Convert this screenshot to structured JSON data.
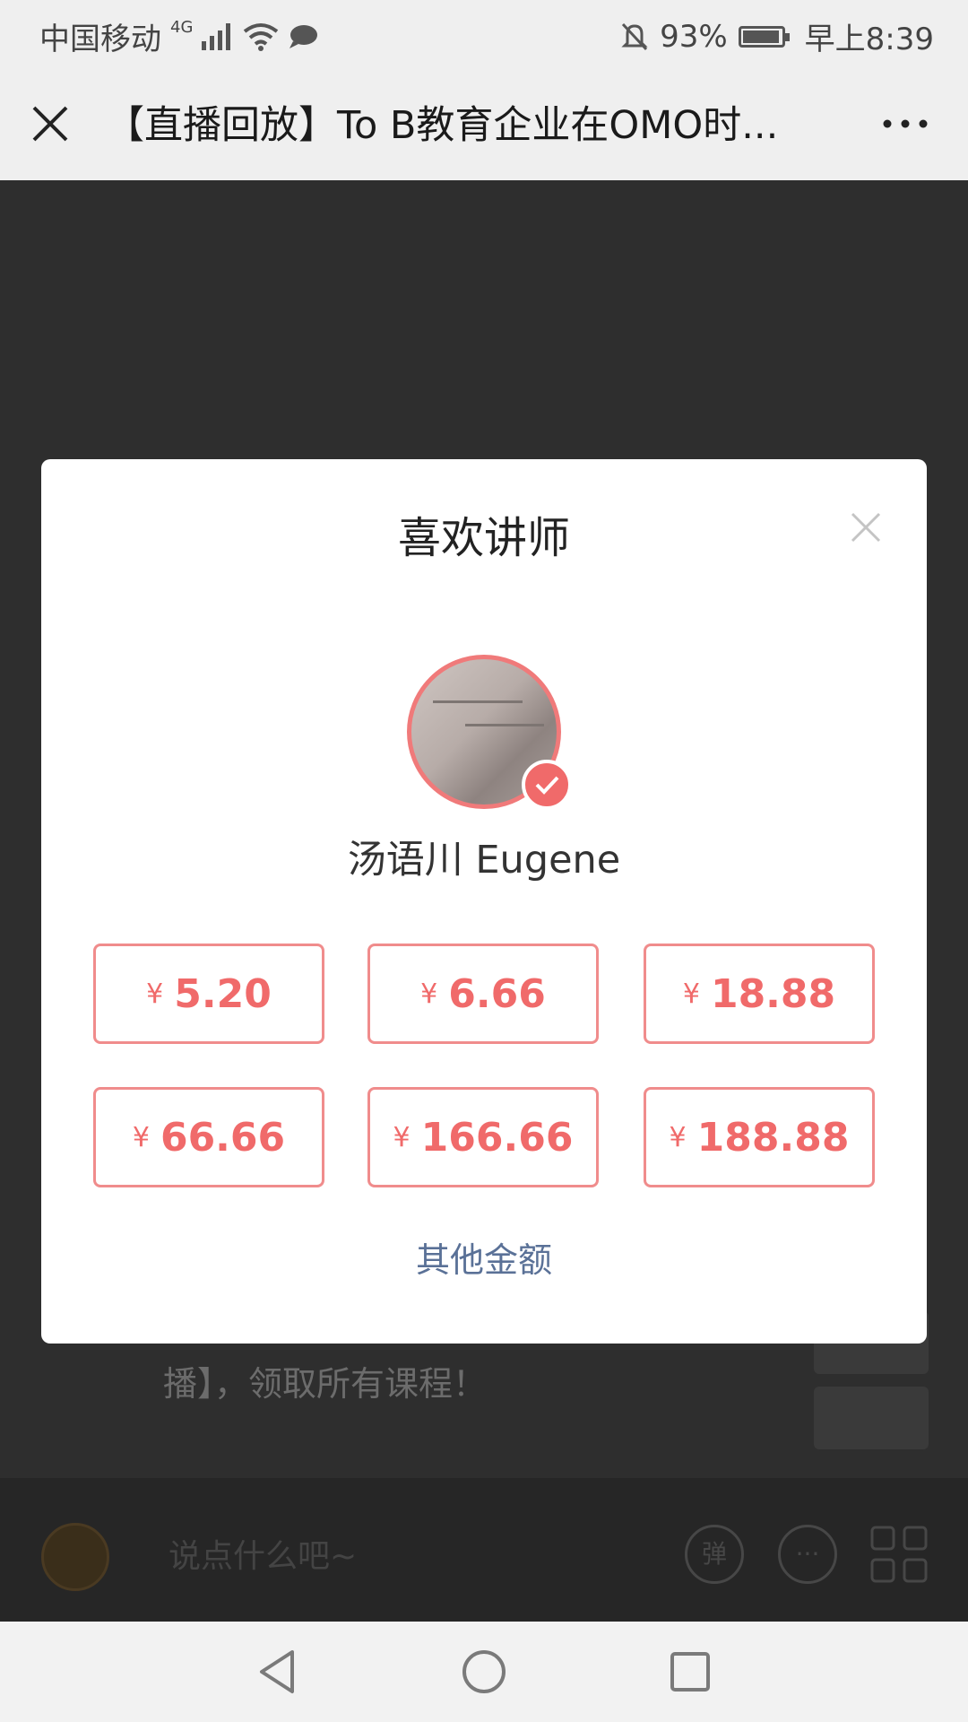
{
  "status_bar": {
    "carrier": "中国移动",
    "network": "4G",
    "battery": "93%",
    "time": "早上8:39"
  },
  "title_bar": {
    "title": "【直播回放】To B教育企业在OMO时..."
  },
  "background": {
    "message_text": "播】，领取所有课程！",
    "input_placeholder": "说点什么吧~",
    "danmu_label": "弹"
  },
  "modal": {
    "title": "喜欢讲师",
    "teacher_name": "汤语川 Eugene",
    "currency_symbol": "¥",
    "amounts": [
      "5.20",
      "6.66",
      "18.88",
      "66.66",
      "166.66",
      "188.88"
    ],
    "other_amount_label": "其他金额",
    "colors": {
      "accent": "#f06a6a",
      "link": "#5a7197"
    }
  }
}
